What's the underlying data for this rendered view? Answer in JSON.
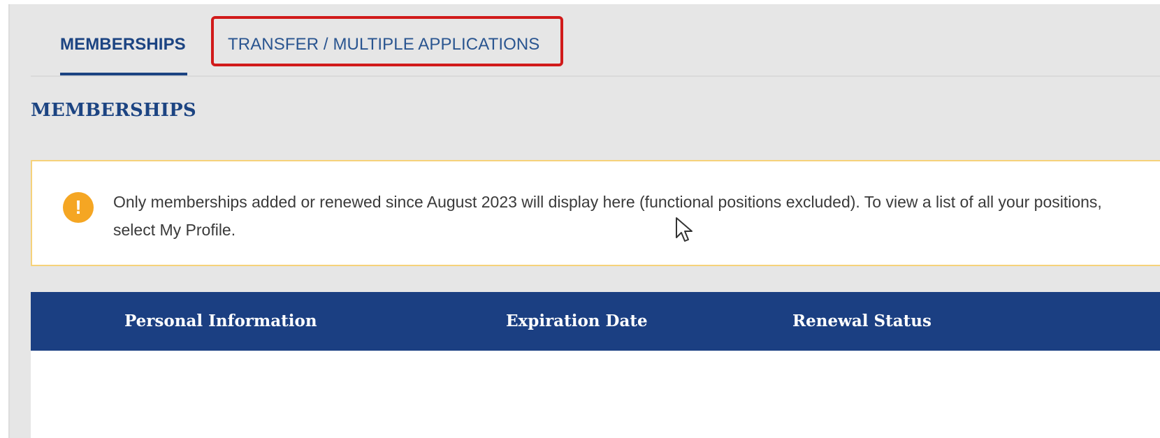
{
  "tabs": [
    {
      "label": "MEMBERSHIPS",
      "active": true
    },
    {
      "label": "TRANSFER / MULTIPLE APPLICATIONS",
      "active": false,
      "highlighted": true
    }
  ],
  "section": {
    "title": "MEMBERSHIPS"
  },
  "notice": {
    "icon": "exclamation-icon",
    "text": "Only memberships added or renewed since August 2023 will display here (functional positions excluded). To view a list of all your positions, select My Profile."
  },
  "table": {
    "columns": [
      "Personal Information",
      "Expiration Date",
      "Renewal Status"
    ],
    "rows": []
  },
  "colors": {
    "primary_blue": "#1b3f82",
    "tab_text": "#1c4482",
    "highlight_red": "#d11a1a",
    "notice_border": "#f6d27a",
    "notice_icon": "#f5a623",
    "page_bg": "#e6e6e6"
  }
}
